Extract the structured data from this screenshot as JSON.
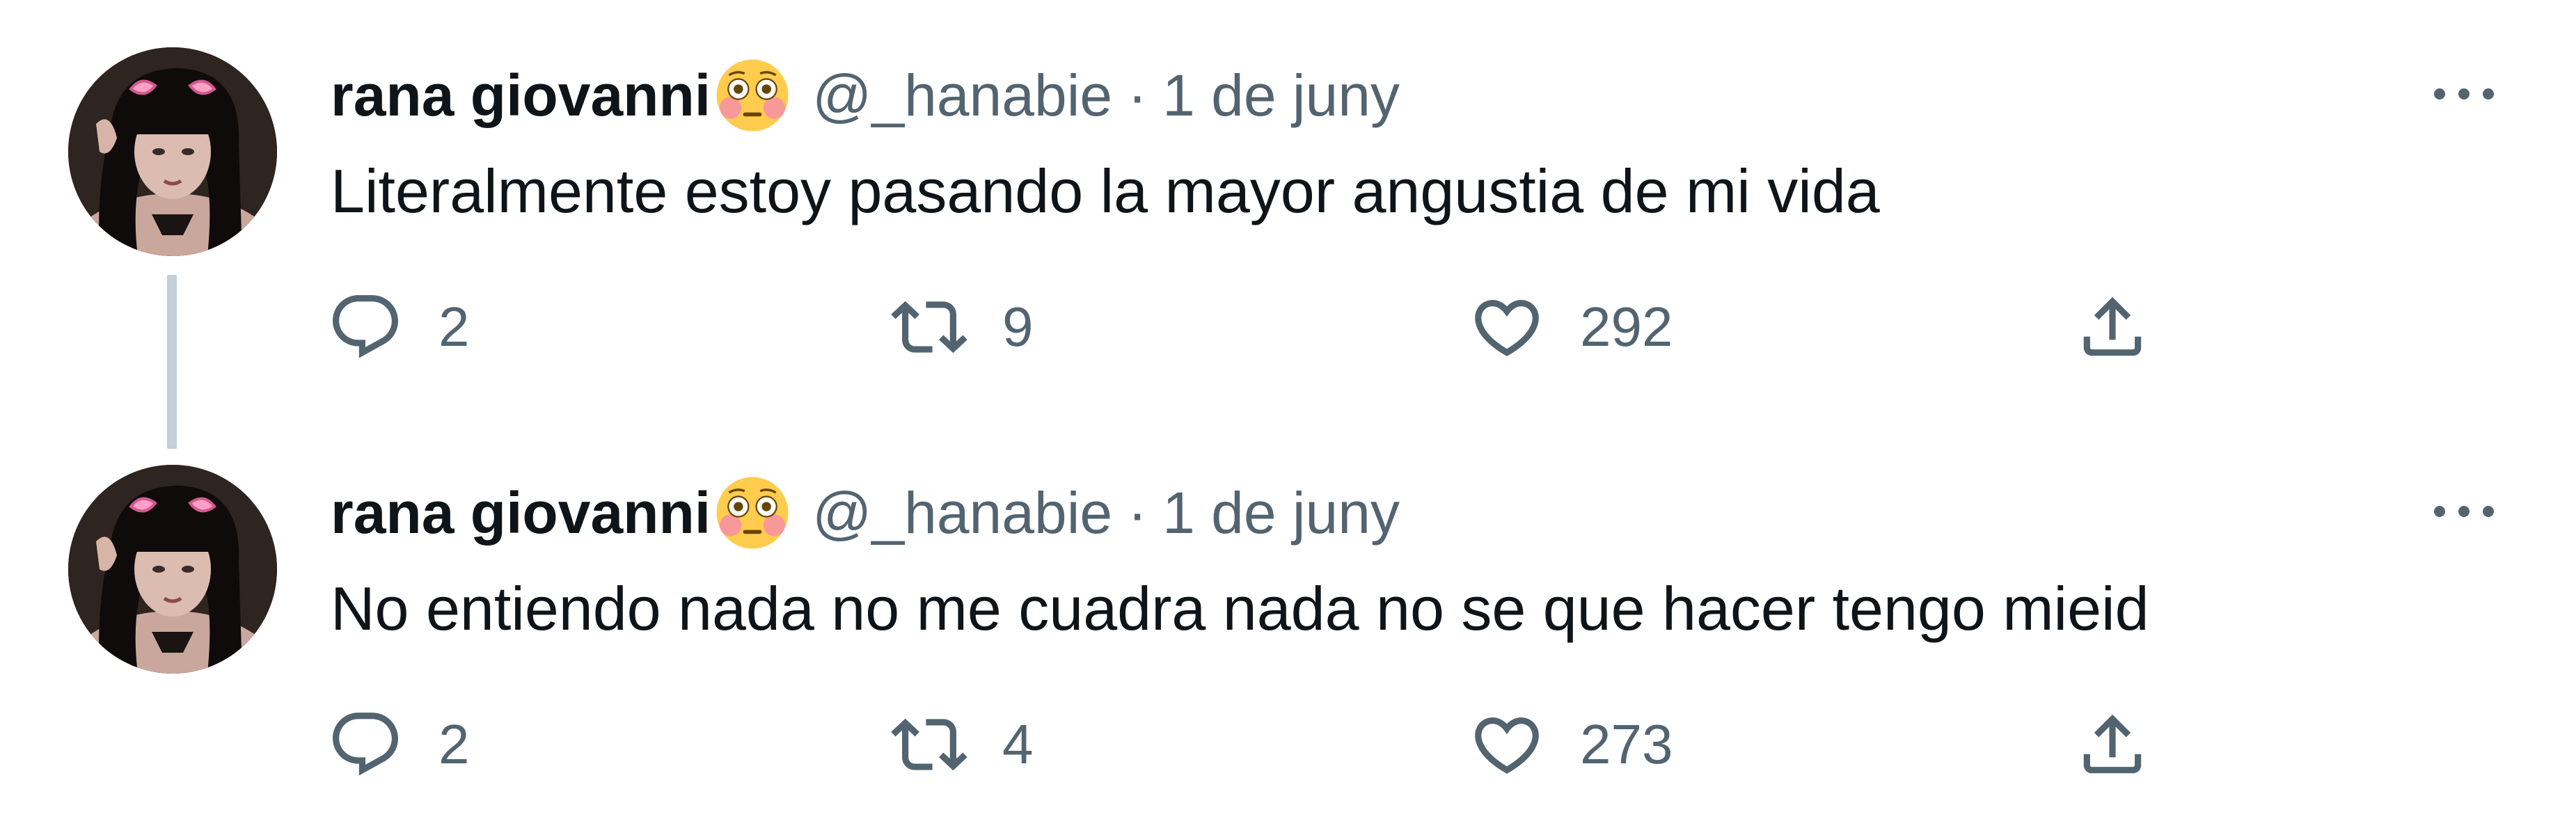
{
  "tweets": [
    {
      "author": {
        "display_name": "rana giovanni",
        "emoji": "flushed-face-emoji",
        "handle": "@_hanabie"
      },
      "separator": "·",
      "date": "1 de juny",
      "text": "Literalmente estoy pasando la mayor angustia de mi vida",
      "stats": {
        "replies": "2",
        "retweets": "9",
        "likes": "292"
      }
    },
    {
      "author": {
        "display_name": "rana giovanni",
        "emoji": "flushed-face-emoji",
        "handle": "@_hanabie"
      },
      "separator": "·",
      "date": "1 de juny",
      "text": "No entiendo nada no me cuadra nada no se que hacer tengo mieid",
      "stats": {
        "replies": "2",
        "retweets": "4",
        "likes": "273"
      }
    }
  ],
  "icons": {
    "more": "more-options-icon",
    "reply": "reply-icon",
    "retweet": "retweet-icon",
    "like": "heart-icon",
    "share": "share-icon"
  },
  "colors": {
    "text": "#0f1419",
    "secondary": "#536471",
    "thread_line": "#c4cfd6"
  }
}
